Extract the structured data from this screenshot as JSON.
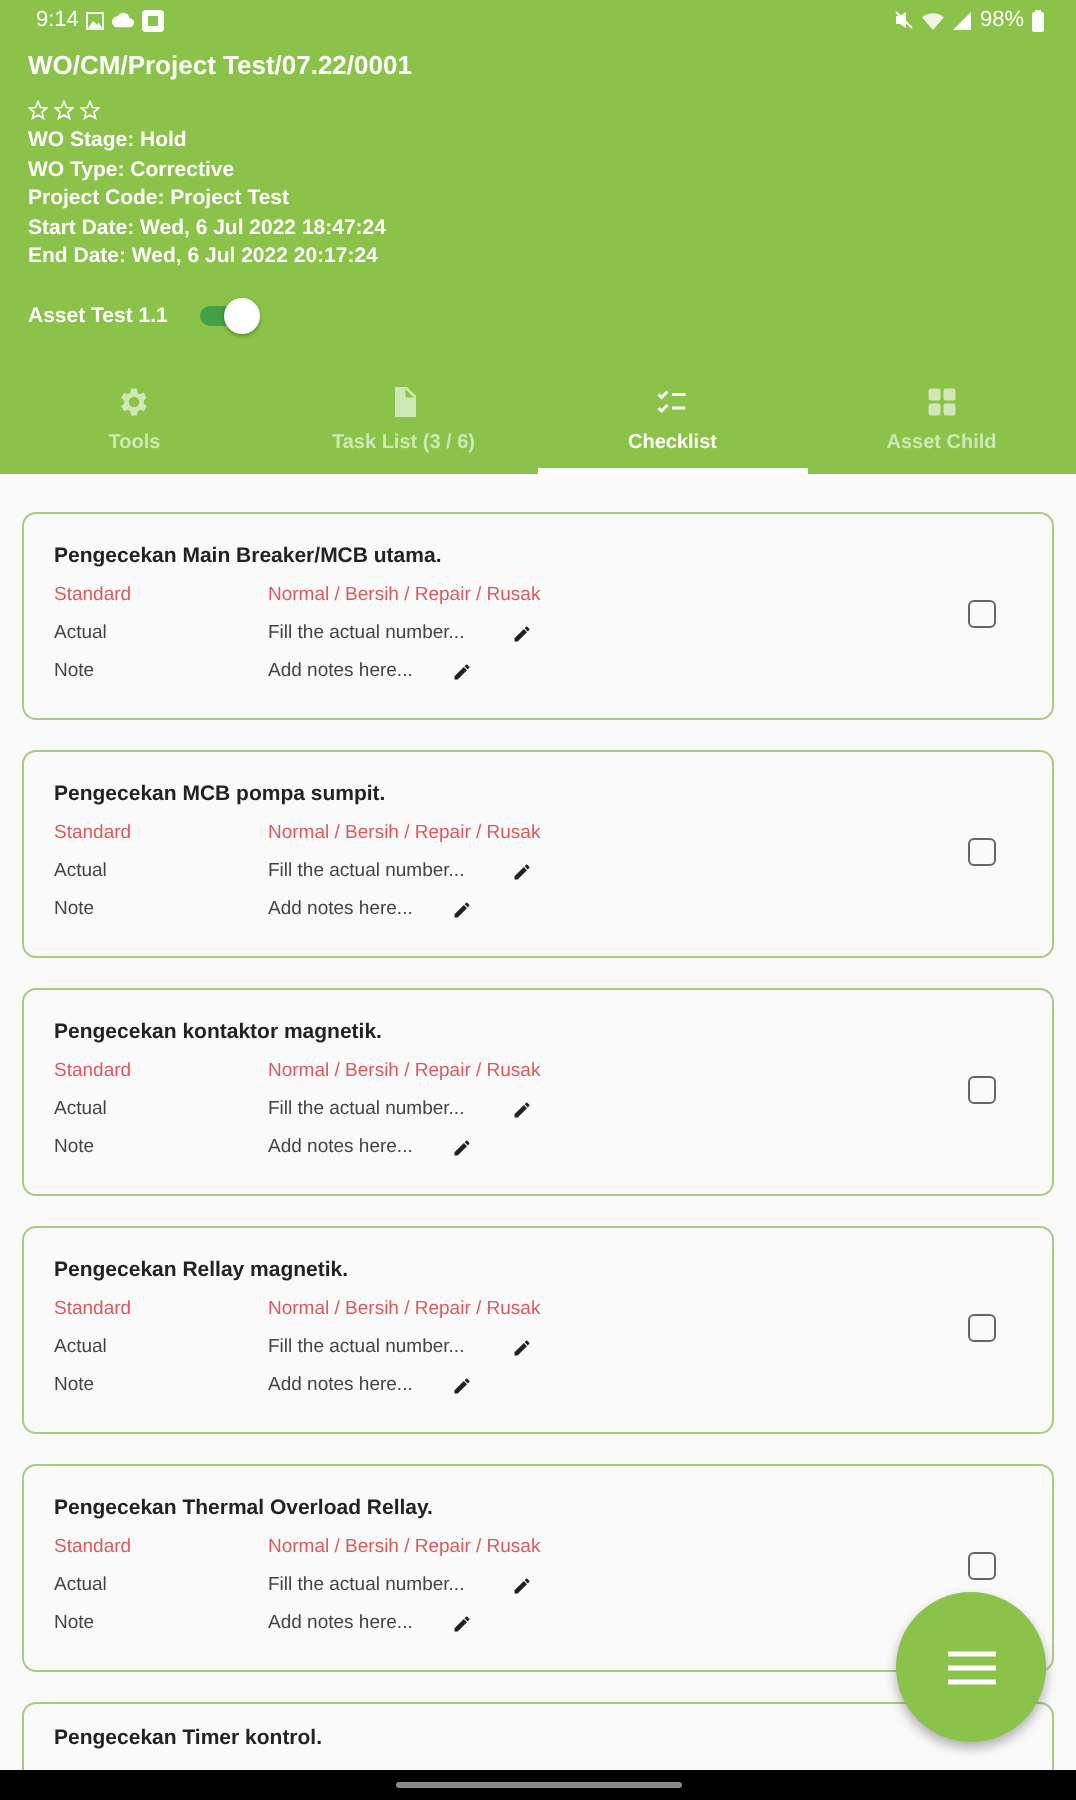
{
  "status_bar": {
    "time": "9:14",
    "battery": "98%"
  },
  "header": {
    "title": "WO/CM/Project Test/07.22/0001",
    "stars": 0,
    "details": [
      "WO Stage: Hold",
      "WO Type: Corrective",
      "Project Code: Project Test",
      "Start Date: Wed, 6 Jul 2022 18:47:24",
      "End Date: Wed, 6 Jul 2022 20:17:24"
    ],
    "asset": {
      "label": "Asset Test 1.1",
      "on": true
    }
  },
  "tabs": [
    {
      "label": "Tools",
      "selected": false
    },
    {
      "label": "Task List (3 / 6)",
      "selected": false
    },
    {
      "label": "Checklist",
      "selected": true
    },
    {
      "label": "Asset Child",
      "selected": false
    }
  ],
  "checklist": [
    {
      "title": "Pengecekan Main Breaker/MCB utama.",
      "standard_label": "Standard",
      "standard": "Normal / Bersih / Repair / Rusak",
      "actual_label": "Actual",
      "actual_placeholder": "Fill the actual number...",
      "note_label": "Note",
      "note_placeholder": "Add notes here...",
      "checked": false
    },
    {
      "title": "Pengecekan MCB pompa sumpit.",
      "standard_label": "Standard",
      "standard": "Normal / Bersih / Repair / Rusak",
      "actual_label": "Actual",
      "actual_placeholder": "Fill the actual number...",
      "note_label": "Note",
      "note_placeholder": "Add notes here...",
      "checked": false
    },
    {
      "title": "Pengecekan kontaktor magnetik.",
      "standard_label": "Standard",
      "standard": "Normal / Bersih / Repair / Rusak",
      "actual_label": "Actual",
      "actual_placeholder": "Fill the actual number...",
      "note_label": "Note",
      "note_placeholder": "Add notes here...",
      "checked": false
    },
    {
      "title": "Pengecekan Rellay magnetik.",
      "standard_label": "Standard",
      "standard": "Normal / Bersih / Repair / Rusak",
      "actual_label": "Actual",
      "actual_placeholder": "Fill the actual number...",
      "note_label": "Note",
      "note_placeholder": "Add notes here...",
      "checked": false
    },
    {
      "title": "Pengecekan Thermal Overload Rellay.",
      "standard_label": "Standard",
      "standard": "Normal / Bersih / Repair / Rusak",
      "actual_label": "Actual",
      "actual_placeholder": "Fill the actual number...",
      "note_label": "Note",
      "note_placeholder": "Add notes here...",
      "checked": false
    },
    {
      "title": "Pengecekan Timer kontrol."
    }
  ]
}
